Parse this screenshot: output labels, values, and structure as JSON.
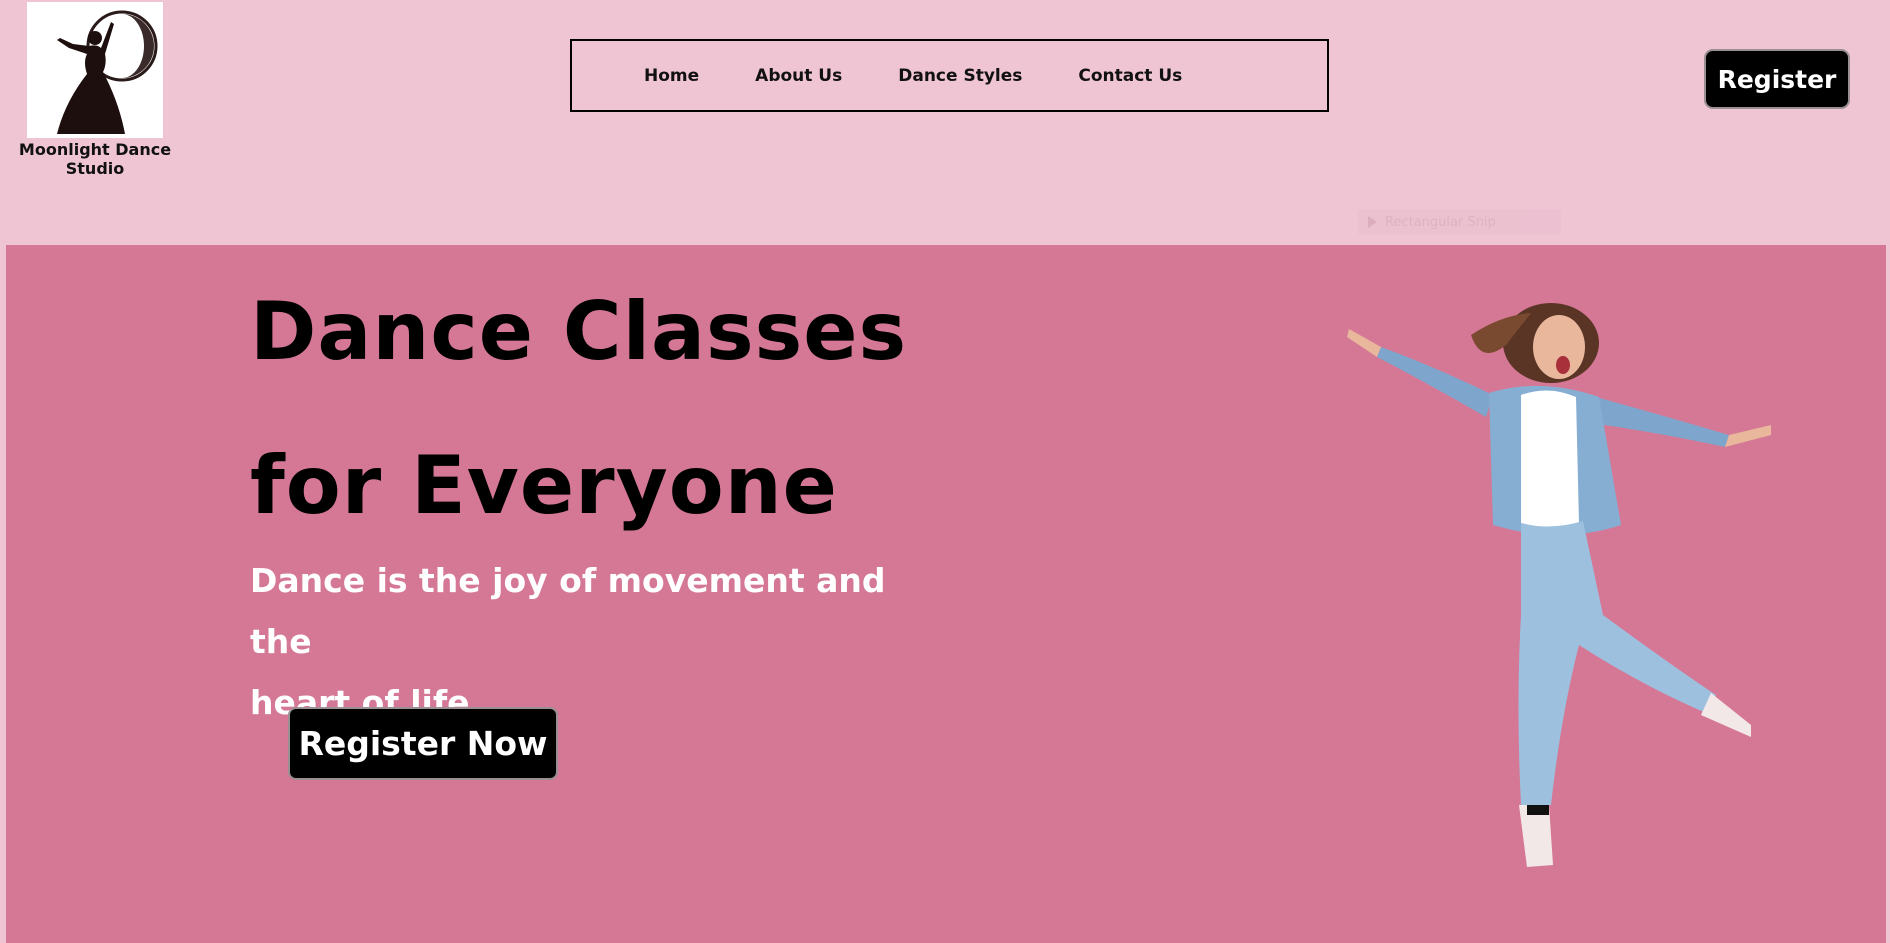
{
  "brand": {
    "name": "Moonlight Dance Studio"
  },
  "nav": {
    "items": [
      "Home",
      "About Us",
      "Dance Styles",
      "Contact Us"
    ]
  },
  "header": {
    "register_label": "Register"
  },
  "overlay": {
    "chip_label": "Rectangular Snip"
  },
  "hero": {
    "title_line1": "Dance Classes",
    "title_line2": "for Everyone",
    "subtitle_line1": "Dance is the joy of movement and the",
    "subtitle_line2": "heart of life.",
    "cta_label": "Register Now"
  },
  "colors": {
    "header_bg": "#efc4d3",
    "hero_bg": "#d57896",
    "button_bg": "#000000",
    "button_text": "#ffffff"
  },
  "icons": {
    "logo": "dancer-moon-logo",
    "hero_image": "jumping-dancer-photo"
  }
}
